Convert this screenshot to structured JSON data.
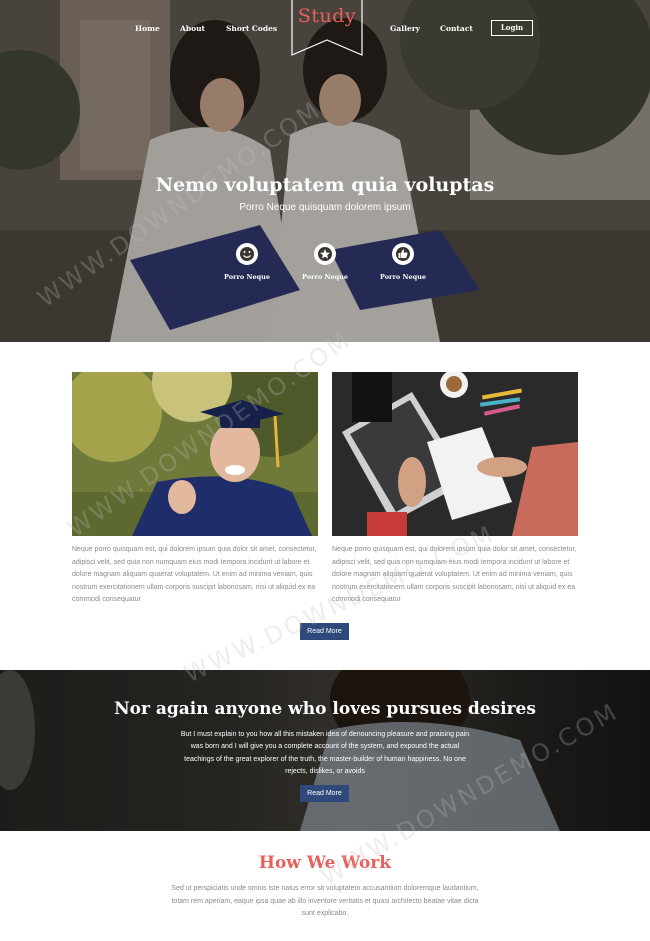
{
  "nav": {
    "items": [
      "Home",
      "About",
      "Short Codes",
      "Gallery",
      "Contact"
    ],
    "logo": "Study",
    "login_label": "Login"
  },
  "hero": {
    "title": "Nemo voluptatem quia voluptas",
    "subtitle": "Porro Neque quisquam dolorem ipsum",
    "features": [
      {
        "icon": "smile-icon",
        "label": "Porro Neque"
      },
      {
        "icon": "star-icon",
        "label": "Porro Neque"
      },
      {
        "icon": "thumbs-up-icon",
        "label": "Porro Neque"
      }
    ]
  },
  "cards": [
    {
      "image": "graduate-photo",
      "text": "Neque porro quisquam est, qui dolorem ipsum quia dolor sit amet, consectetur, adipisci velit, sed quia non numquam eius modi tempora incidunt ut labore et dolore magnam aliquam quaerat voluptatem. Ut enim ad minima veniam, quis nostrum exercitationem ullam corporis suscipit laboriosam, nisi ut aliquid ex ea commodi consequatur"
    },
    {
      "image": "laptop-desk-photo",
      "text": "Neque porro quisquam est, qui dolorem ipsum quia dolor sit amet, consectetur, adipisci velit, sed quia non numquam eius modi tempora incidunt ut labore et dolore magnam aliquam quaerat voluptatem. Ut enim ad minima veniam, quis nostrum exercitationem ullam corporis suscipit laboriosam, nisi ut aliquid ex ea commodi consequatur"
    }
  ],
  "read_more_label": "Read More",
  "banner": {
    "title": "Nor again anyone who loves pursues desires",
    "text": "But I must explain to you how all this mistaken idea of denouncing pleasure and praising pain was born and I will give you a complete account of the system, and expound the actual teachings of the great explorer of the truth, the master-builder of human happiness. No one rejects, dislikes, or avoids",
    "button_label": "Read More"
  },
  "how": {
    "title": "How We Work",
    "text": "Sed ut perspiciatis unde omnis iste natus error sit voluptatem accusantium doloremque laudantium, totam rem aperiam, eaque ipsa quae ab illo inventore veritatis et quasi architecto beatae vitae dicta sunt explicabo."
  },
  "watermark": "WWW.DOWNDEMO.COM",
  "colors": {
    "accent": "#e8605c",
    "button": "#2f4a7a"
  }
}
